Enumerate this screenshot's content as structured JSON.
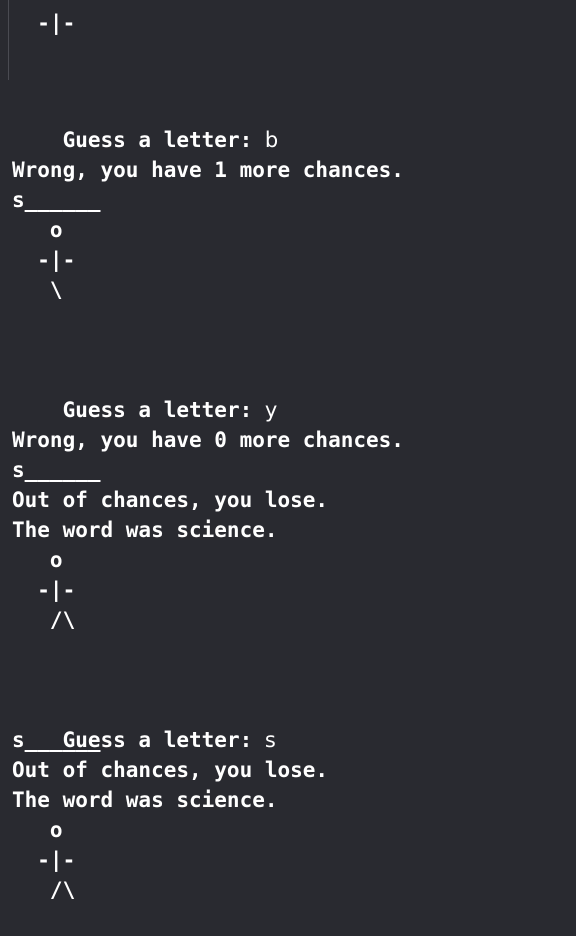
{
  "console": {
    "lines": [
      "  -|-",
      "Guess a letter: ",
      "b",
      "Wrong, you have 1 more chances.",
      "s______",
      "   o",
      "  -|-",
      "   \\",
      "Guess a letter: ",
      "y",
      "Wrong, you have 0 more chances.",
      "s______",
      "Out of chances, you lose.",
      "The word was science.",
      "   o",
      "  -|-",
      "   /\\",
      "Guess a letter: ",
      "s",
      "s______",
      "Out of chances, you lose.",
      "The word was science.",
      "   o",
      "  -|-",
      "   /\\"
    ]
  }
}
